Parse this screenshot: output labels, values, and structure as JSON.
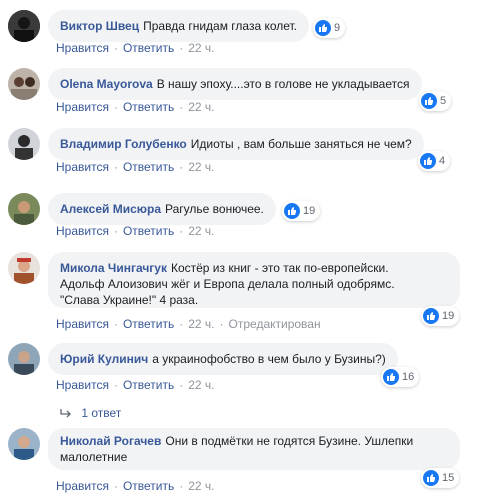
{
  "actions": {
    "like_label": "Нравится",
    "reply_label": "Ответить",
    "dot": "·",
    "edited_label": "Отредактирован"
  },
  "comments": [
    {
      "author": "Виктор Швец",
      "text": "Правда гнидам глаза колет.",
      "reactions": "9",
      "time": "22 ч."
    },
    {
      "author": "Olena Mayorova",
      "text": "В нашу эпоху....это в голове не укладывается",
      "reactions": "5",
      "time": "22 ч."
    },
    {
      "author": "Владимир Голубенко",
      "text": "Идиоты , вам больше заняться не чем?",
      "reactions": "4",
      "time": "22 ч."
    },
    {
      "author": "Алексей Мисюра",
      "text": "Рагулье вонючее.",
      "reactions": "19",
      "time": "22 ч."
    },
    {
      "author": "Микола Чингачгук",
      "text_lines": [
        "Костёр из книг - это так по-европейски.",
        "Адольф Алоизович жёг и Европа делала полный одобрямс.",
        "\"Слава Украине!\" 4 раза."
      ],
      "reactions": "19",
      "time": "22 ч."
    },
    {
      "author": "Юрий Кулинич",
      "text": "а украинофобство в чем было у Бузины?)",
      "reactions": "16",
      "time": "22 ч.",
      "replies_label": "1 ответ"
    },
    {
      "author": "Николай Рогачев",
      "text_lines": [
        "Они в подмётки не годятся Бузине. Ушлепки",
        "малолетние"
      ],
      "reactions": "15",
      "time": "22 ч."
    }
  ],
  "colors": {
    "link": "#385898",
    "bubble": "#f2f3f5",
    "like_blue": "#1877f2",
    "meta": "#90949c"
  },
  "icons": {
    "like": "thumbs-up-icon",
    "reply_arrow": "reply-arrow-icon"
  }
}
